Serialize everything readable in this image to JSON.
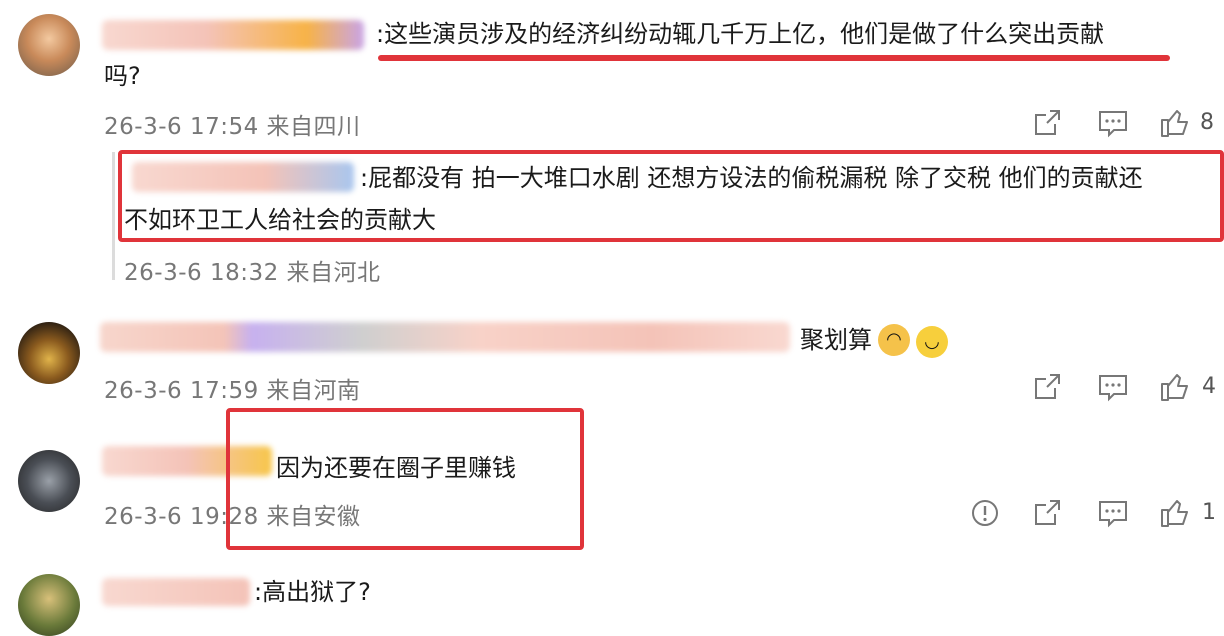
{
  "comments": [
    {
      "text": ":这些演员涉及的经济纠纷动辄几千万上亿，他们是做了什么突出贡献",
      "text_cont": "吗?",
      "meta": "26-3-6 17:54 来自四川",
      "likes": "8",
      "reply": {
        "text": ":屁都没有 拍一大堆口水剧 还想方设法的偷税漏税 除了交税 他们的贡献还",
        "text_cont": "不如环卫工人给社会的贡献大",
        "meta": "26-3-6 18:32 来自河北"
      }
    },
    {
      "text": "聚划算",
      "meta": "26-3-6 17:59 来自河南",
      "likes": "4"
    },
    {
      "text": "因为还要在圈子里赚钱",
      "meta": "26-3-6 19:28 来自安徽",
      "likes": "1"
    },
    {
      "text": ":高出狱了?"
    }
  ],
  "colors": {
    "highlight": "#e0343a",
    "meta": "#777777"
  },
  "icons": [
    "share-icon",
    "comment-icon",
    "like-icon",
    "report-icon",
    "cat-emoji-icon",
    "crying-emoji-icon"
  ]
}
